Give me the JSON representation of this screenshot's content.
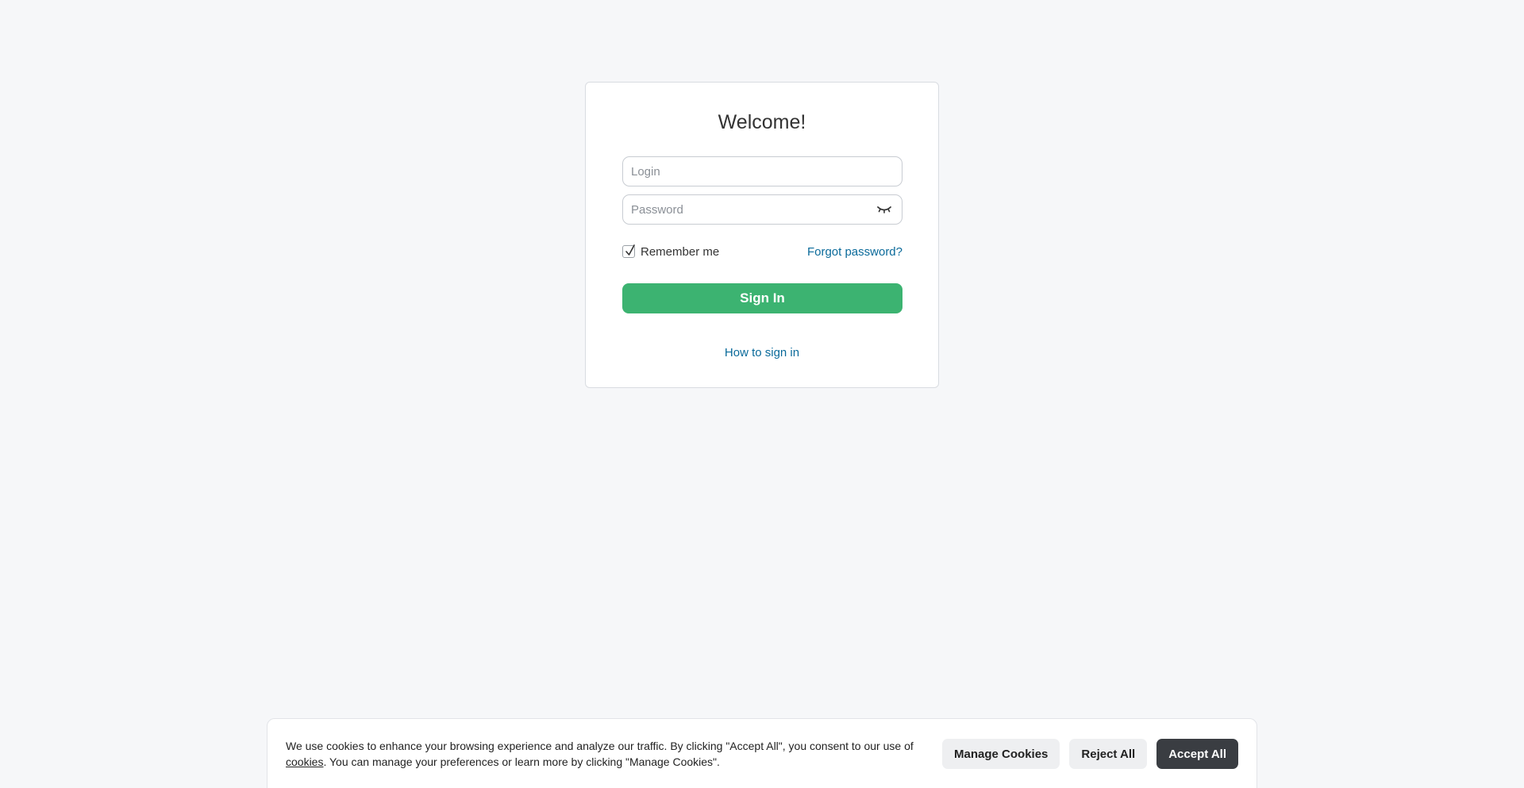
{
  "login": {
    "title": "Welcome!",
    "login_placeholder": "Login",
    "password_placeholder": "Password",
    "remember_label": "Remember me",
    "remember_checked": true,
    "forgot_label": "Forgot password?",
    "signin_label": "Sign In",
    "howto_label": "How to sign in",
    "password_toggle_icon": "eye-closed-icon"
  },
  "cookie_banner": {
    "text_before_link": "We use cookies to enhance your browsing experience and analyze our traffic. By clicking \"Accept All\", you consent to our use of ",
    "link_label": "cookies",
    "text_after_link": ". You can manage your preferences or learn more by clicking \"Manage Cookies\".",
    "manage_label": "Manage Cookies",
    "reject_label": "Reject All",
    "accept_label": "Accept All"
  },
  "colors": {
    "signin_button": "#3cb371",
    "link": "#0a6a9a",
    "accept_button": "#3a3d42",
    "background": "#f6f7f9"
  }
}
